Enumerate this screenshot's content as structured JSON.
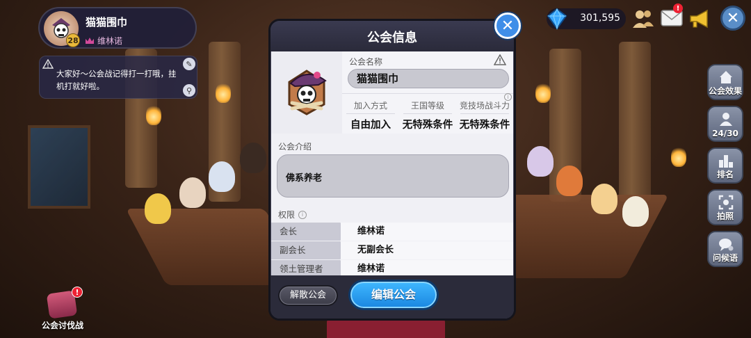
{
  "profile": {
    "name": "猫猫围巾",
    "level": "28",
    "leader_name": "维林诺"
  },
  "notice": {
    "text": "大家好～公会战记得打一打哦，挂机打就好啦。"
  },
  "hud": {
    "gems": "301,595",
    "mail_badge": "!"
  },
  "side_menu": {
    "guild_effect": "公会效果",
    "members": "24/30",
    "ranking": "排名",
    "photo": "拍照",
    "greeting": "问候语"
  },
  "guild_battle": {
    "label": "公会讨伐战",
    "badge": "!"
  },
  "modal": {
    "title": "公会信息",
    "guild_name_label": "公会名称",
    "guild_name": "猫猫围巾",
    "join_method_label": "加入方式",
    "join_method": "自由加入",
    "kingdom_level_label": "王国等级",
    "kingdom_level": "无特殊条件",
    "arena_power_label": "竞技场战斗力",
    "arena_power": "无特殊条件",
    "intro_label": "公会介绍",
    "intro": "佛系养老",
    "permissions_label": "权限",
    "permissions": [
      {
        "role": "会长",
        "holder": "维林诺"
      },
      {
        "role": "副会长",
        "holder": "无副会长"
      },
      {
        "role": "领土管理者",
        "holder": "维林诺"
      }
    ],
    "disband_button": "解散公会",
    "edit_button": "编辑公会"
  },
  "colors": {
    "accent_blue": "#3f8ee8",
    "edit_button": "#1a86e0",
    "panel_bg": "#f0f0f5",
    "frame": "#2b2b3a"
  }
}
